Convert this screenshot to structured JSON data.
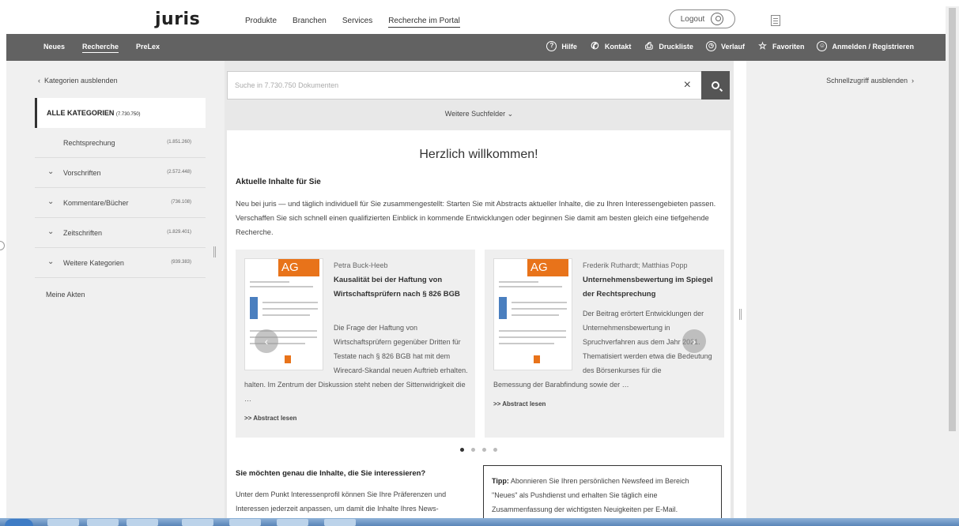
{
  "brand": {
    "logo": "juris"
  },
  "top_nav": [
    "Produkte",
    "Branchen",
    "Services",
    "Recherche im Portal"
  ],
  "logout_label": "Logout",
  "dark_nav": {
    "left": [
      "Neues",
      "Recherche",
      "PreLex"
    ],
    "right": [
      "Hilfe",
      "Kontakt",
      "Druckliste",
      "Verlauf",
      "Favoriten",
      "Anmelden / Registrieren"
    ]
  },
  "sidebar": {
    "hide_label": "Kategorien ausblenden",
    "all": {
      "label": "ALLE KATEGORIEN",
      "count": "(7.730.750)"
    },
    "items": [
      {
        "label": "Rechtsprechung",
        "count": "(1.851.260)"
      },
      {
        "label": "Vorschriften",
        "count": "(2.572.448)"
      },
      {
        "label": "Kommentare/Bücher",
        "count": "(736.108)"
      },
      {
        "label": "Zeitschriften",
        "count": "(1.829.401)"
      },
      {
        "label": "Weitere Kategorien",
        "count": "(939.383)"
      }
    ],
    "meine_akten": "Meine Akten"
  },
  "search": {
    "placeholder": "Suche in 7.730.750 Dokumenten",
    "more_fields": "Weitere Suchfelder"
  },
  "welcome": {
    "title": "Herzlich willkommen!",
    "heading": "Aktuelle Inhalte für Sie",
    "intro": "Neu bei juris — und täglich individuell für Sie zusammengestellt: Starten Sie mit Abstracts aktueller Inhalte, die zu Ihren Interessengebieten passen. Verschaffen Sie sich schnell einen qualifizierten Einblick in kommende Entwicklungen oder beginnen Sie damit am besten gleich eine tiefgehende Recherche."
  },
  "cards": [
    {
      "badge": "AG",
      "author": "Petra Buck-Heeb",
      "title": "Kausalität bei der Haftung von Wirtschaftsprüfern nach § 826 BGB",
      "text_side": "Die Frage der Haftung von Wirtschaftsprüfern gegenüber Dritten für Testate nach § 826 BGB hat mit dem Wirecard-Skandal neuen Auftrieb erhalten.",
      "text_full": "halten. Im Zentrum der Diskussion steht neben der Sittenwidrigkeit die …",
      "read_more": ">> Abstract lesen"
    },
    {
      "badge": "AG",
      "author": "Frederik Ruthardt; Matthias Popp",
      "title": "Unternehmensbewertung im Spiegel der Rechtsprechung",
      "text_side": "Der Beitrag erörtert Entwicklungen der Unternehmensbewertung in Spruchverfahren aus dem Jahr 2021. Thematisiert werden etwa die Bedeutung des Börsenkurses für die",
      "text_full": "Bemessung der Barabfindung sowie der …",
      "read_more": ">> Abstract lesen"
    }
  ],
  "carousel": {
    "active_index": 0,
    "total": 4
  },
  "bottom": {
    "heading": "Sie möchten genau die Inhalte, die Sie interessieren?",
    "text": "Unter dem Punkt Interessenprofil können Sie Ihre Präferenzen und Interessen jederzeit anpassen, um damit die Inhalte Ihres News-",
    "tipp_label": "Tipp:",
    "tipp_text": "Abonnieren Sie Ihren persönlichen Newsfeed im Bereich \"Neues\" als Pushdienst und erhalten Sie täglich eine Zusammenfassung der wichtigsten Neuigkeiten per E-Mail."
  },
  "right_panel": {
    "hide_label": "Schnellzugriff ausblenden"
  },
  "colors": {
    "dark_bar": "#626262",
    "accent": "#e8731a",
    "panel_bg": "#f0f0f0"
  }
}
